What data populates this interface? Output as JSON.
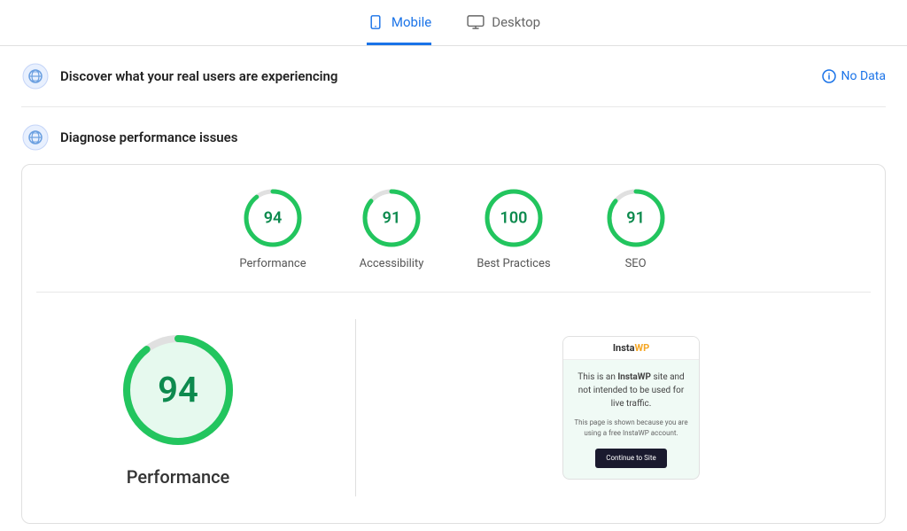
{
  "tabs": [
    {
      "id": "mobile",
      "label": "Mobile",
      "active": true
    },
    {
      "id": "desktop",
      "label": "Desktop",
      "active": false
    }
  ],
  "real_users": {
    "title": "Discover what your real users are experiencing",
    "no_data_label": "No Data"
  },
  "diagnose": {
    "title": "Diagnose performance issues"
  },
  "scores": [
    {
      "id": "performance",
      "value": "94",
      "label": "Performance"
    },
    {
      "id": "accessibility",
      "value": "91",
      "label": "Accessibility"
    },
    {
      "id": "best-practices",
      "value": "100",
      "label": "Best Practices"
    },
    {
      "id": "seo",
      "value": "91",
      "label": "SEO"
    }
  ],
  "detail": {
    "score": "94",
    "label": "Performance"
  },
  "screenshot": {
    "brand_prefix": "Insta",
    "brand_suffix": "WP",
    "main_text_prefix": "This is an ",
    "main_text_brand": "InstaWP",
    "main_text_suffix": " site and not intended to be used for live traffic.",
    "sub_text": "This page is shown because you are using a free InstaWP account.",
    "button_label": "Continue to Site"
  },
  "colors": {
    "green": "#1db954",
    "green_stroke": "#22c55e",
    "green_bg": "#e6f9ee",
    "blue": "#1a73e8",
    "track": "#e0e0e0"
  }
}
